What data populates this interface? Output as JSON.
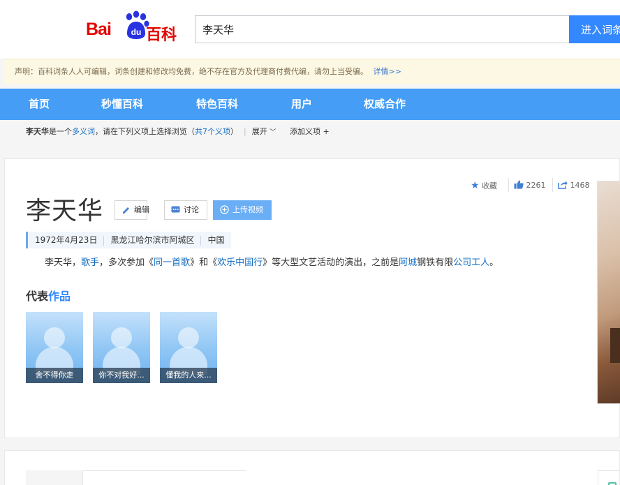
{
  "header": {
    "logo": {
      "bai": "Bai",
      "du": "du",
      "baike": "百科"
    },
    "search_value": "李天华",
    "search_button": "进入词条"
  },
  "notice": {
    "text": "声明：百科词条人人可编辑，词条创建和修改均免费，绝不存在官方及代理商付费代编，请勿上当受骗。",
    "more": "详情>>"
  },
  "nav": {
    "items": [
      {
        "label": "首页"
      },
      {
        "label": "秒懂百科"
      },
      {
        "label": "特色百科"
      },
      {
        "label": "用户"
      },
      {
        "label": "权威合作"
      }
    ]
  },
  "polysemant": {
    "name": "李天华",
    "text1": "是一个",
    "link1": "多义词",
    "text2": "，请在下列义项上选择浏览（",
    "link2": "共7个义项",
    "text3": "）",
    "expand": "展开",
    "add": "添加义项 +"
  },
  "lemma": {
    "title": "李天华",
    "buttons": {
      "edit": "编辑",
      "discuss": "讨论",
      "upload": "上传视频"
    },
    "stats": {
      "collect": "收藏",
      "likes": "2261",
      "shares": "1468"
    },
    "info": [
      "1972年4月23日",
      "黑龙江哈尔滨市阿城区",
      "中国"
    ],
    "summary": {
      "p1": "李天华，",
      "l1": "歌手",
      "p2": "，多次参加《",
      "l2": "同一首歌",
      "p3": "》和《",
      "l3": "欢乐中国行",
      "p4": "》等大型文艺活动的演出，之前是",
      "l4": "阿城",
      "p5": "钢铁有限",
      "l5": "公司",
      "l6": "工人",
      "p6": "。"
    },
    "works_title": {
      "a": "代表",
      "b": "作品"
    },
    "works": [
      {
        "caption": "舍不得你走"
      },
      {
        "caption": "你不对我好..."
      },
      {
        "caption": "懂我的人来..."
      }
    ]
  },
  "colors": {
    "nav_bg": "#459df5",
    "link": "#136ec2",
    "brand_red": "#e10601",
    "upload_btn": "#6aaef5"
  }
}
